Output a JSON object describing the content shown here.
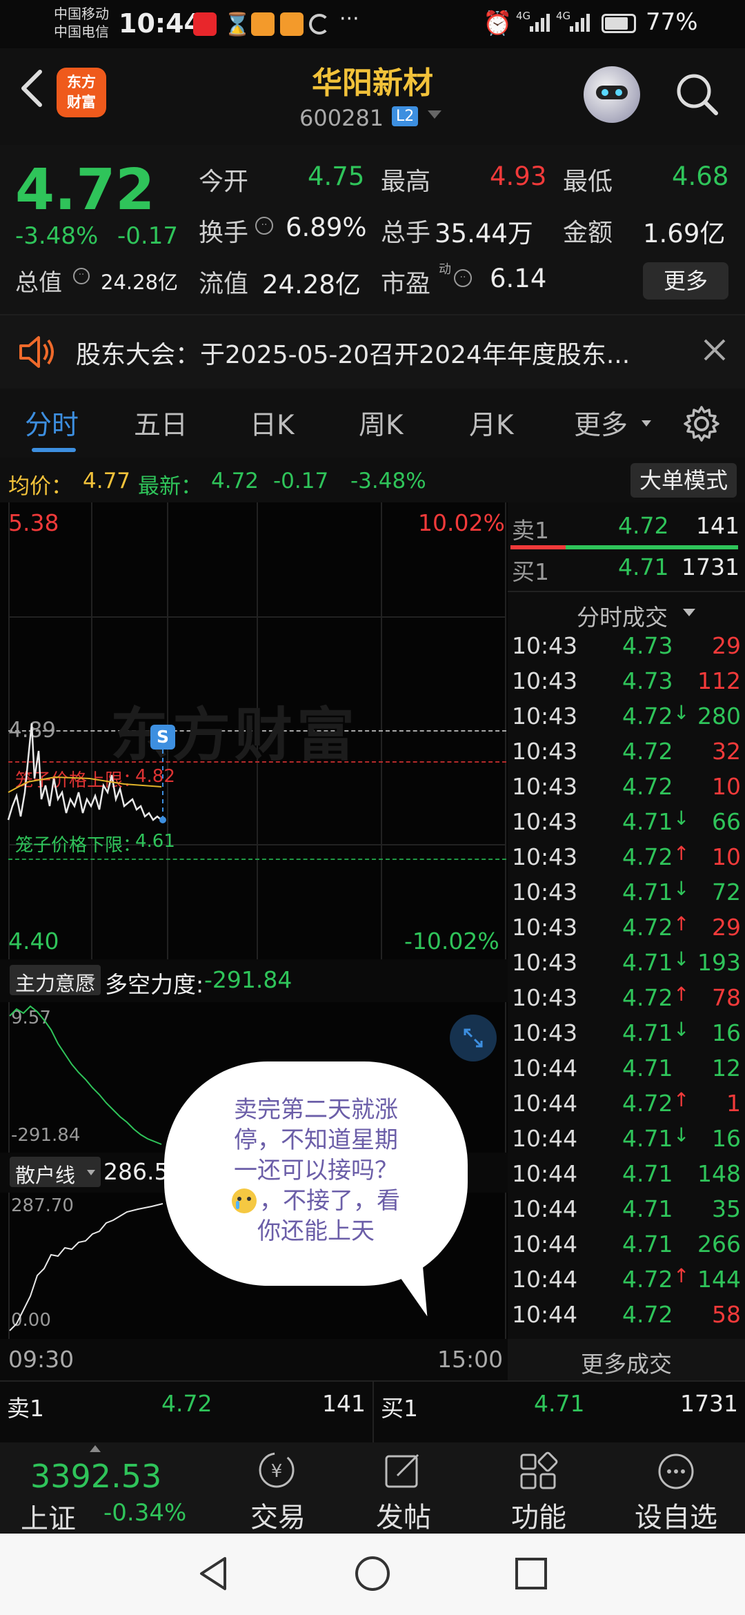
{
  "status": {
    "carrier1": "中国移动",
    "carrier2": "中国电信",
    "time": "10:44",
    "battery": "77%",
    "signal1": "4G",
    "signal2": "4G",
    "more": "···"
  },
  "header": {
    "logo_line1": "东方",
    "logo_line2": "财富",
    "title": "华阳新材",
    "code": "600281",
    "level_badge": "L2"
  },
  "quote": {
    "price": "4.72",
    "change_pct": "-3.48%",
    "change": "-0.17",
    "open_label": "今开",
    "open": "4.75",
    "high_label": "最高",
    "high": "4.93",
    "low_label": "最低",
    "low": "4.68",
    "turnover_label": "换手",
    "turnover": "6.89%",
    "volume_label": "总手",
    "volume": "35.44万",
    "amount_label": "金额",
    "amount": "1.69亿",
    "mktcap_label": "总值",
    "mktcap": "24.28亿",
    "float_label": "流值",
    "float": "24.28亿",
    "pe_label": "市盈",
    "pe_sup": "动",
    "pe": "6.14",
    "more_button": "更多"
  },
  "notice": {
    "text": "股东大会：于2025-05-20召开2024年年度股东..."
  },
  "tabs": [
    "分时",
    "五日",
    "日K",
    "周K",
    "月K",
    "更多"
  ],
  "active_tab": 0,
  "avgbar": {
    "avg_label": "均价：",
    "avg": "4.77",
    "latest_label": "最新：",
    "latest": "4.72",
    "change": "-0.17",
    "change_pct": "-3.48%",
    "mode_button": "大单模式"
  },
  "chart": {
    "top_price": "5.38",
    "top_pct": "10.02%",
    "bottom_price": "4.40",
    "bottom_pct": "-10.02%",
    "ref_price": "4.89",
    "upper_cage_label": "笼子价格上限：",
    "upper_cage": "4.82",
    "lower_cage_label": "笼子价格下限：",
    "lower_cage": "4.61",
    "s_marker": "S",
    "watermark": "东方财富",
    "time_start": "09:30",
    "time_end": "15:00"
  },
  "indicator1": {
    "name": "主力意愿",
    "label": "多空力度:",
    "value": "-291.84",
    "top_value": "9.57",
    "bottom_value": "-291.84"
  },
  "indicator2": {
    "name": "散户线",
    "value": "286.5",
    "top_value": "287.70",
    "bottom_value": "0.00"
  },
  "bubble": {
    "lines": [
      "卖完第二天就涨",
      "停，不知道星期",
      "一还可以接吗？",
      "，不接了，看",
      "你还能上天"
    ]
  },
  "orderbook_top": {
    "sell_label": "卖1",
    "sell_price": "4.72",
    "sell_vol": "141",
    "buy_label": "买1",
    "buy_price": "4.71",
    "buy_vol": "1731"
  },
  "trades_header": "分时成交",
  "trades": [
    {
      "time": "10:43",
      "price": "4.73",
      "arrow": "",
      "vol": "29",
      "color": "red"
    },
    {
      "time": "10:43",
      "price": "4.73",
      "arrow": "",
      "vol": "112",
      "color": "red"
    },
    {
      "time": "10:43",
      "price": "4.72",
      "arrow": "↓",
      "vol": "280",
      "color": "green"
    },
    {
      "time": "10:43",
      "price": "4.72",
      "arrow": "",
      "vol": "32",
      "color": "red"
    },
    {
      "time": "10:43",
      "price": "4.72",
      "arrow": "",
      "vol": "10",
      "color": "red"
    },
    {
      "time": "10:43",
      "price": "4.71",
      "arrow": "↓",
      "vol": "66",
      "color": "green"
    },
    {
      "time": "10:43",
      "price": "4.72",
      "arrow": "↑",
      "vol": "10",
      "color": "red"
    },
    {
      "time": "10:43",
      "price": "4.71",
      "arrow": "↓",
      "vol": "72",
      "color": "green"
    },
    {
      "time": "10:43",
      "price": "4.72",
      "arrow": "↑",
      "vol": "29",
      "color": "red"
    },
    {
      "time": "10:43",
      "price": "4.71",
      "arrow": "↓",
      "vol": "193",
      "color": "green"
    },
    {
      "time": "10:43",
      "price": "4.72",
      "arrow": "↑",
      "vol": "78",
      "color": "red"
    },
    {
      "time": "10:43",
      "price": "4.71",
      "arrow": "↓",
      "vol": "16",
      "color": "green"
    },
    {
      "time": "10:44",
      "price": "4.71",
      "arrow": "",
      "vol": "12",
      "color": "green"
    },
    {
      "time": "10:44",
      "price": "4.72",
      "arrow": "↑",
      "vol": "1",
      "color": "red"
    },
    {
      "time": "10:44",
      "price": "4.71",
      "arrow": "↓",
      "vol": "16",
      "color": "green"
    },
    {
      "time": "10:44",
      "price": "4.71",
      "arrow": "",
      "vol": "148",
      "color": "green"
    },
    {
      "time": "10:44",
      "price": "4.71",
      "arrow": "",
      "vol": "35",
      "color": "green"
    },
    {
      "time": "10:44",
      "price": "4.71",
      "arrow": "",
      "vol": "266",
      "color": "green"
    },
    {
      "time": "10:44",
      "price": "4.72",
      "arrow": "↑",
      "vol": "144",
      "color": "green"
    },
    {
      "time": "10:44",
      "price": "4.72",
      "arrow": "",
      "vol": "58",
      "color": "red"
    }
  ],
  "more_trades": "更多成交",
  "bottom_book": {
    "sell_label": "卖1",
    "sell_price": "4.72",
    "sell_vol": "141",
    "buy_label": "买1",
    "buy_price": "4.71",
    "buy_vol": "1731"
  },
  "bottomnav": {
    "index_value": "3392.53",
    "index_name": "上证",
    "index_change": "-0.34%",
    "trade": "交易",
    "post": "发帖",
    "function": "功能",
    "watchlist": "设自选"
  },
  "colors": {
    "up": "#f23a3a",
    "down": "#2fc45a",
    "accent": "#3d8fe0",
    "brand": "#ef5a1c",
    "title": "#f2c23a"
  }
}
